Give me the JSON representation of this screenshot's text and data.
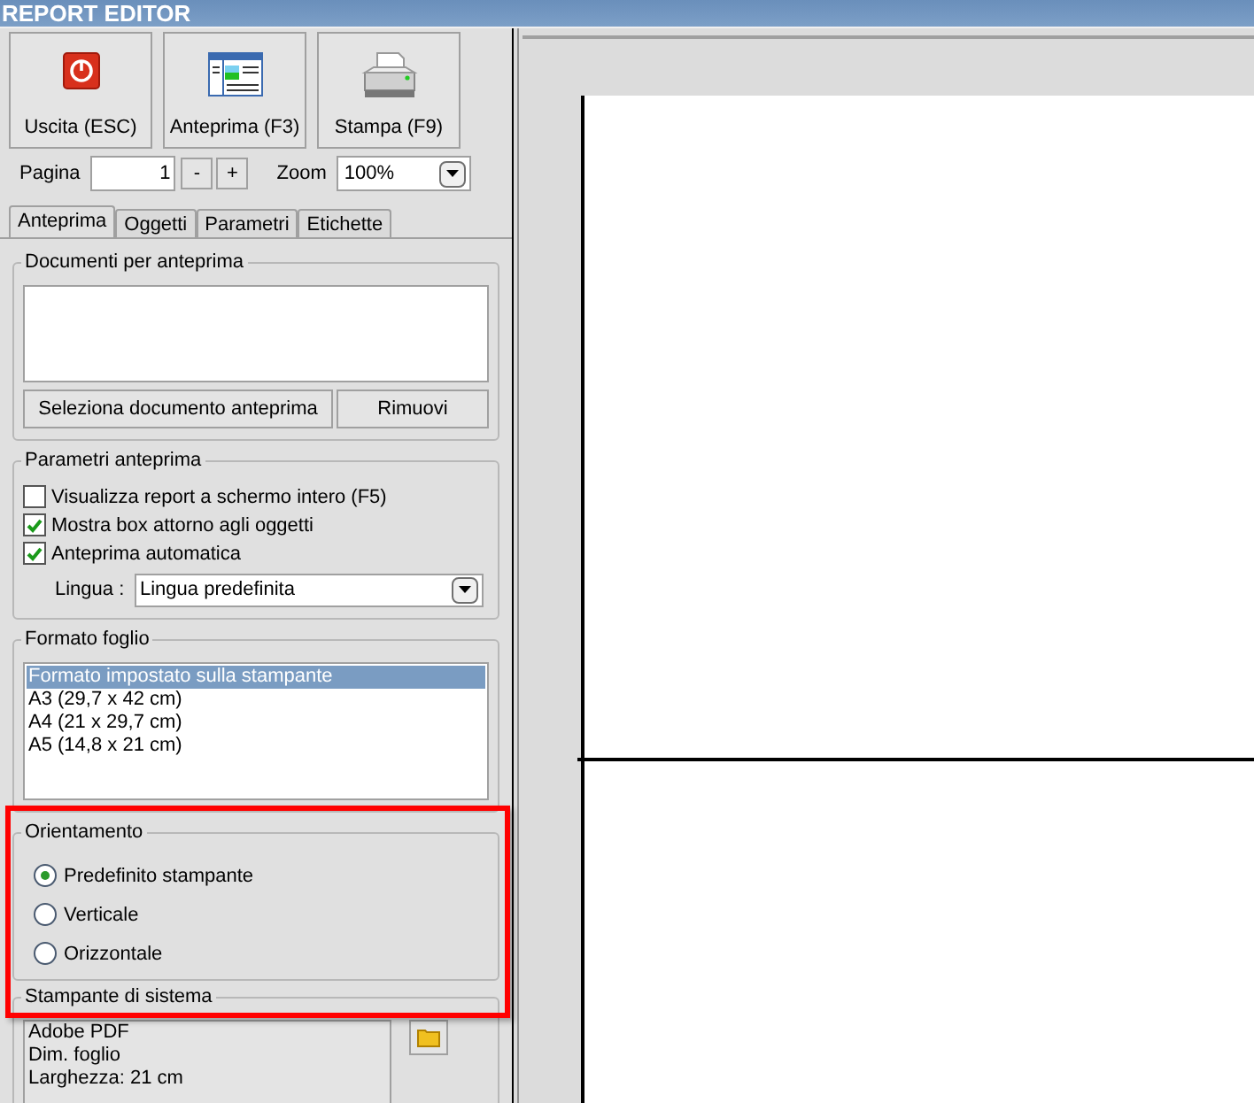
{
  "window": {
    "title": "REPORT EDITOR"
  },
  "toolbar": [
    {
      "kind": "exit",
      "label": "Uscita (ESC)"
    },
    {
      "kind": "preview",
      "label": "Anteprima (F3)"
    },
    {
      "kind": "print",
      "label": "Stampa (F9)"
    }
  ],
  "page": {
    "label": "Pagina",
    "value": "1",
    "minus": "-",
    "plus": "+"
  },
  "zoom": {
    "label": "Zoom",
    "value": "100%"
  },
  "tabs": [
    {
      "label": "Anteprima",
      "selected": true
    },
    {
      "label": "Oggetti",
      "selected": false
    },
    {
      "label": "Parametri",
      "selected": false
    },
    {
      "label": "Etichette",
      "selected": false
    }
  ],
  "documents": {
    "title": "Documenti per anteprima",
    "buttons": [
      "Seleziona documento anteprima",
      "Rimuovi"
    ]
  },
  "preview_params": {
    "title": "Parametri anteprima",
    "options": [
      {
        "label": "Visualizza report a schermo intero (F5)",
        "checked": false
      },
      {
        "label": "Mostra box attorno agli oggetti",
        "checked": true
      },
      {
        "label": "Anteprima automatica",
        "checked": true
      }
    ],
    "language": {
      "label": "Lingua :",
      "value": "Lingua predefinita"
    }
  },
  "sheet_format": {
    "title": "Formato foglio",
    "items": [
      {
        "label": "Formato impostato sulla stampante",
        "selected": true
      },
      {
        "label": "A3 (29,7 x 42 cm)",
        "selected": false
      },
      {
        "label": "A4 (21 x 29,7 cm)",
        "selected": false
      },
      {
        "label": "A5 (14,8 x 21 cm)",
        "selected": false
      }
    ]
  },
  "orientation": {
    "title": "Orientamento",
    "highlighted": true,
    "options": [
      {
        "label": "Predefinito stampante",
        "selected": true
      },
      {
        "label": "Verticale",
        "selected": false
      },
      {
        "label": "Orizzontale",
        "selected": false
      }
    ]
  },
  "system_printer": {
    "title": "Stampante di sistema",
    "lines": [
      "Adobe PDF",
      "Dim. foglio",
      "Larghezza: 21 cm"
    ]
  }
}
